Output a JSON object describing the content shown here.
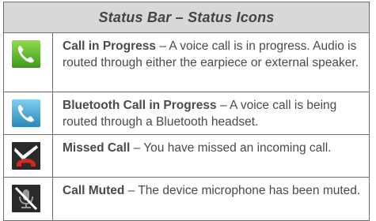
{
  "table": {
    "title": "Status Bar – Status Icons",
    "separator": " – ",
    "rows": [
      {
        "icon": "call-in-progress-icon",
        "name": "Call in Progress",
        "description": "A voice call is in progress. Audio is routed through either the earpiece or external speaker."
      },
      {
        "icon": "bluetooth-call-in-progress-icon",
        "name": "Bluetooth Call in Progress",
        "description": "A voice call is being routed through a Bluetooth headset."
      },
      {
        "icon": "missed-call-icon",
        "name": "Missed Call",
        "description": "You have missed an incoming call."
      },
      {
        "icon": "call-muted-icon",
        "name": "Call Muted",
        "description": "The device microphone has been muted."
      }
    ]
  },
  "colors": {
    "header_bg": "#d8d8d8",
    "border": "#6e6e6e",
    "text": "#4a4a4a",
    "green_icon": "#5bbd2c",
    "blue_icon": "#3a9fd0",
    "dark_icon": "#2a2a2a",
    "red_handset": "#d42a1e"
  }
}
